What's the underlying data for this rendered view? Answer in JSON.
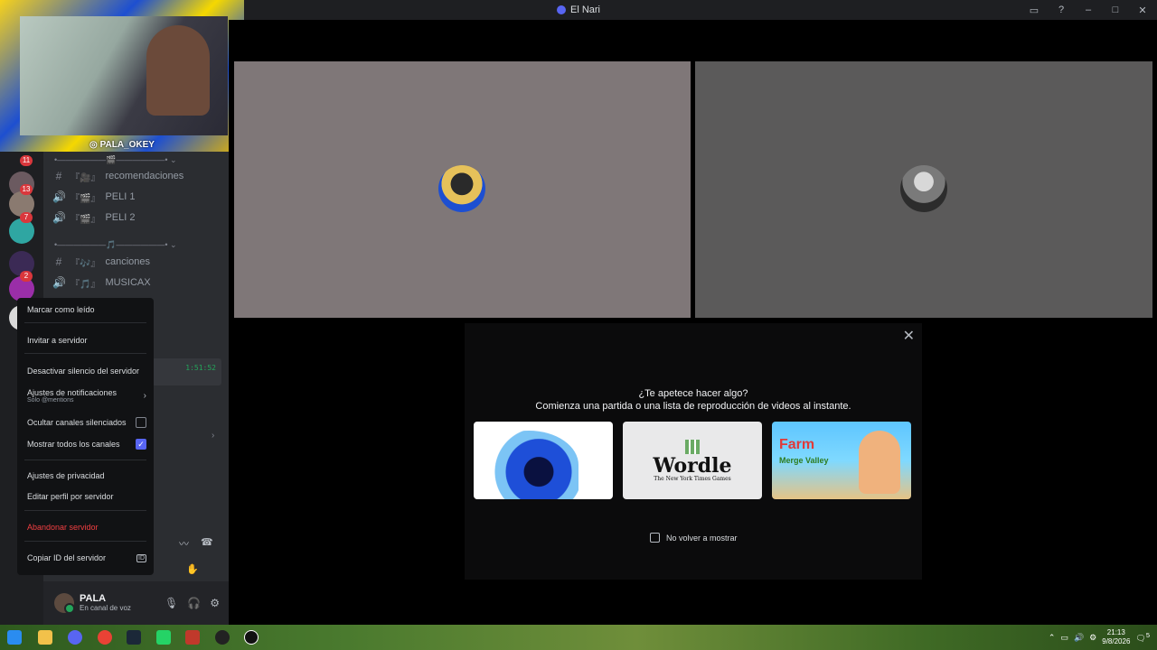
{
  "window": {
    "title": "El Nari"
  },
  "webcam": {
    "handle": "PALA_OKEY"
  },
  "rail": {
    "badges": [
      "11",
      "13",
      "7",
      "2"
    ]
  },
  "channels": [
    {
      "type": "text",
      "prefix": "『🎥』",
      "name": "recomendaciones"
    },
    {
      "type": "voice",
      "prefix": "『🎬』",
      "name": "PELI 1"
    },
    {
      "type": "voice",
      "prefix": "『🎬』",
      "name": "PELI 2"
    },
    {
      "type": "text",
      "prefix": "『🎶』",
      "name": "canciones"
    },
    {
      "type": "voice",
      "prefix": "『🎵』",
      "name": "MUSICAX"
    }
  ],
  "voice_timer": "1:51:52",
  "user": {
    "name": "PALA",
    "status": "En canal de voz"
  },
  "context_menu": {
    "mark_read": "Marcar como leído",
    "invite": "Invitar a servidor",
    "unmute": "Desactivar silencio del servidor",
    "notif_settings": "Ajustes de notificaciones",
    "notif_sub": "Solo @mentions",
    "hide_muted": "Ocultar canales silenciados",
    "show_all": "Mostrar todos los canales",
    "privacy": "Ajustes de privacidad",
    "edit_profile": "Editar perfil por servidor",
    "leave": "Abandonar servidor",
    "copy_id": "Copiar ID del servidor",
    "id_badge": "ID",
    "show_all_checked": true,
    "hide_muted_checked": false
  },
  "activity": {
    "question": "¿Te apetece hacer algo?",
    "subtitle": "Comienza una partida o una lista de reproducción de videos al instante.",
    "wordle_title": "Wordle",
    "wordle_sub": "The New York Times Games",
    "farm_title": "Farm",
    "farm_sub": "Merge Valley",
    "dont_show": "No volver a mostrar"
  },
  "taskbar": {
    "time": "21:13",
    "date": "9/8/2026",
    "notif_count": "5"
  },
  "colors": {
    "accent": "#5865f2",
    "danger": "#f23f42",
    "tile1": "#7f7778",
    "tile2": "#5b5a5a"
  }
}
